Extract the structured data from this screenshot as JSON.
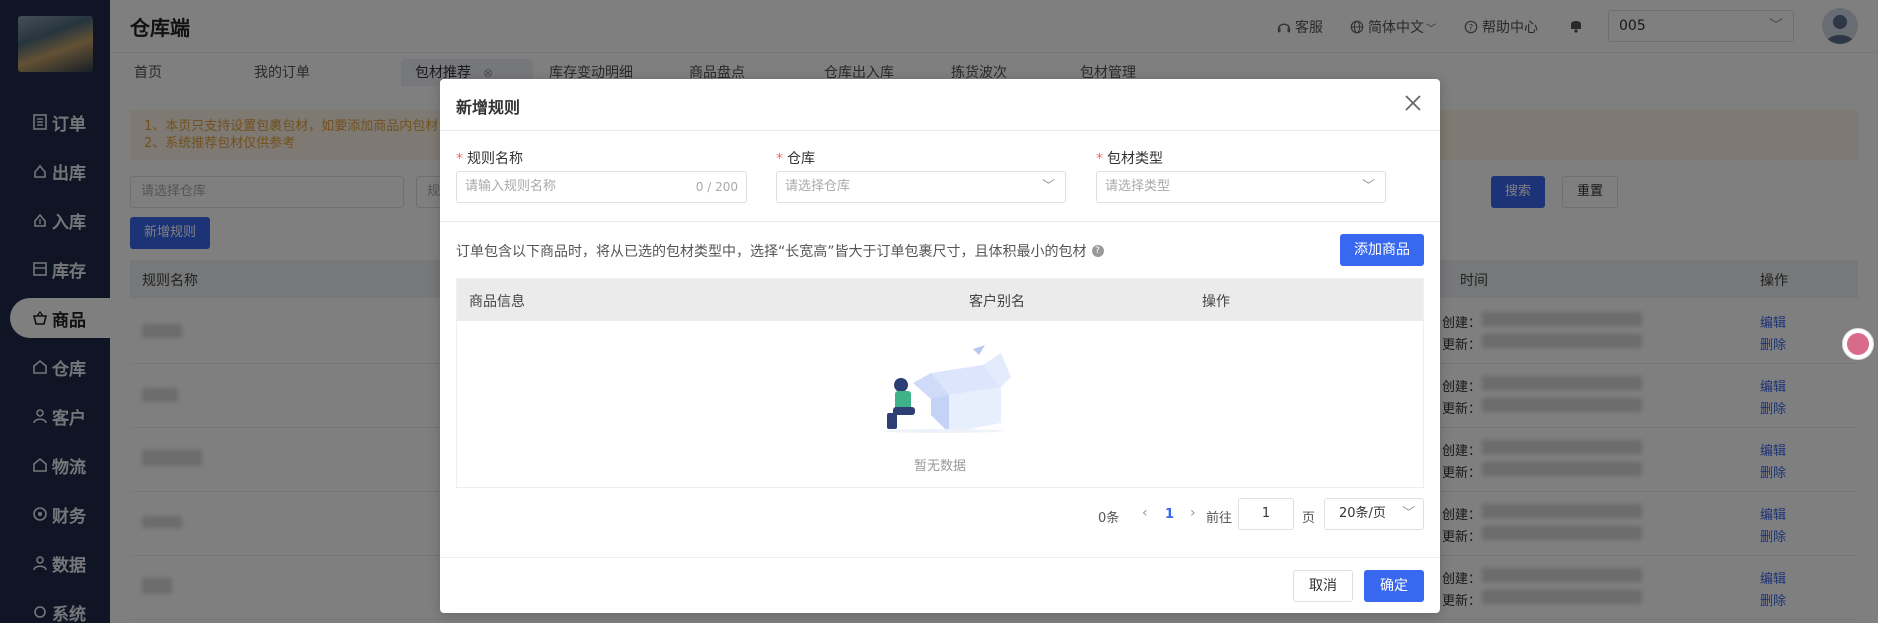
{
  "app": {
    "title": "仓库端"
  },
  "header": {
    "service": "客服",
    "language": "简体中文",
    "help": "帮助中心",
    "warehouse_select": "005"
  },
  "sidebar": {
    "items": [
      {
        "label": "订单",
        "icon": "document-icon"
      },
      {
        "label": "出库",
        "icon": "outbound-icon"
      },
      {
        "label": "入库",
        "icon": "inbound-icon"
      },
      {
        "label": "库存",
        "icon": "inventory-icon"
      },
      {
        "label": "商品",
        "icon": "basket-icon",
        "active": true
      },
      {
        "label": "仓库",
        "icon": "warehouse-icon"
      },
      {
        "label": "客户",
        "icon": "user-icon"
      },
      {
        "label": "物流",
        "icon": "logistics-icon"
      },
      {
        "label": "财务",
        "icon": "finance-icon"
      },
      {
        "label": "数据",
        "icon": "data-icon"
      },
      {
        "label": "系统",
        "icon": "system-icon"
      }
    ]
  },
  "tabs": [
    {
      "label": "首页"
    },
    {
      "label": "我的订单"
    },
    {
      "label": "包材推荐",
      "active": true
    },
    {
      "label": "库存变动明细"
    },
    {
      "label": "商品盘点"
    },
    {
      "label": "仓库出入库"
    },
    {
      "label": "拣货波次"
    },
    {
      "label": "包材管理"
    }
  ],
  "page": {
    "notice_line1": "1、本页只支持设置包裹包材，如要添加商品内包材",
    "notice_line2": "2、系统推荐包材仅供参考",
    "filter_warehouse_placeholder": "请选择仓库",
    "filter_rule_placeholder": "规",
    "search_button": "搜索",
    "reset_button": "重置",
    "new_rule_button": "新增规则",
    "table": {
      "col_rule_name": "规则名称",
      "col_time": "时间",
      "col_action": "操作",
      "created_label": "创建：",
      "updated_label": "更新：",
      "edit_link": "编辑",
      "delete_link": "删除"
    }
  },
  "modal": {
    "title": "新增规则",
    "rule_name_label": "规则名称",
    "rule_name_placeholder": "请输入规则名称",
    "rule_name_counter": "0 / 200",
    "warehouse_label": "仓库",
    "warehouse_placeholder": "请选择仓库",
    "package_type_label": "包材类型",
    "package_type_placeholder": "请选择类型",
    "description": "订单包含以下商品时，将从已选的包材类型中，选择“长宽高”皆大于订单包裹尺寸，且体积最小的包材",
    "add_product_button": "添加商品",
    "table": {
      "col_product_info": "商品信息",
      "col_customer_alias": "客户别名",
      "col_action": "操作",
      "empty_text": "暂无数据"
    },
    "pagination": {
      "total": "0条",
      "current_page": "1",
      "goto_label": "前往",
      "goto_value": "1",
      "page_label": "页",
      "page_size": "20条/页"
    },
    "cancel_button": "取消",
    "confirm_button": "确定"
  }
}
